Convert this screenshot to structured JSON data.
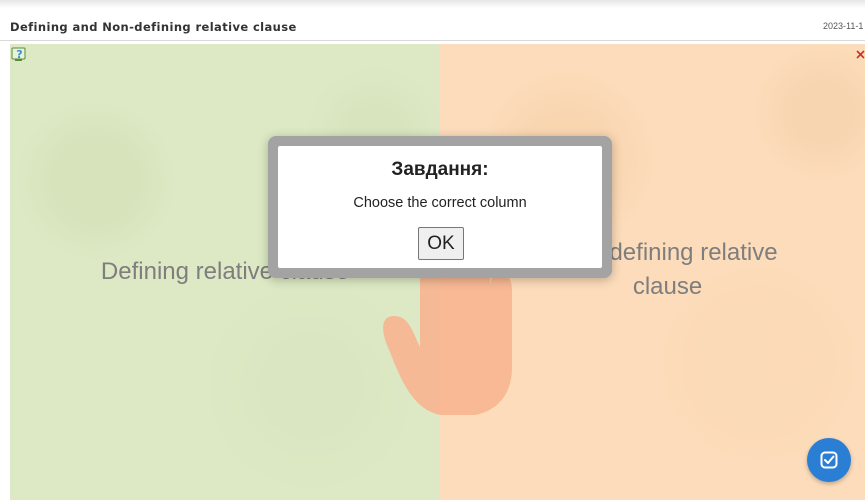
{
  "header": {
    "title": "Defining and Non-defining relative clause",
    "date": "2023-11-1"
  },
  "columns": [
    {
      "label": "Defining relative clause"
    },
    {
      "label": "Non-defining relative clause"
    }
  ],
  "dialog": {
    "title": "Завдання:",
    "message": "Choose the correct column",
    "ok_label": "OK"
  },
  "icons": {
    "help": "help-icon",
    "close": "close-icon",
    "check": "check-icon",
    "hand": "hand-icon"
  },
  "colors": {
    "left_column": "#dde9c4",
    "right_column": "#fcdcba",
    "hand": "#f7b590",
    "check_button": "#2a7fd4"
  }
}
